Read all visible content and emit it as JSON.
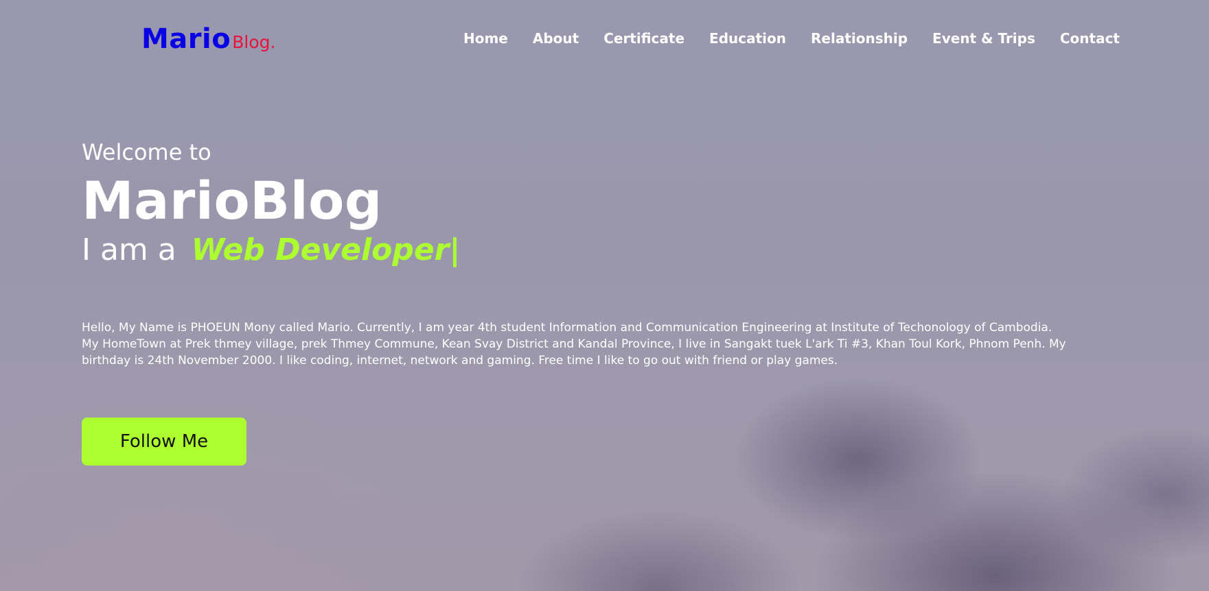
{
  "navbar": {
    "logo": {
      "main": "Mario",
      "sub": "Blog."
    },
    "links": [
      {
        "label": "Home"
      },
      {
        "label": "About"
      },
      {
        "label": "Certificate"
      },
      {
        "label": "Education"
      },
      {
        "label": "Relationship"
      },
      {
        "label": "Event & Trips"
      },
      {
        "label": "Contact"
      }
    ]
  },
  "hero": {
    "welcome": "Welcome to",
    "title": "MarioBlog",
    "role_prefix": "I am a",
    "role": "Web Developer|",
    "bio": "Hello, My Name is PHOEUN Mony called Mario. Currently, I am year 4th student Information and Communication Engineering at Institute of Techonology of Cambodia. My HomeTown at Prek thmey village, prek Thmey Commune, Kean Svay District and Kandal Province, I live in Sangakt tuek L'ark Ti #3, Khan Toul Kork, Phnom Penh. My birthday is 24th November 2000. I like coding, internet, network and gaming. Free time I like to go out with friend or play games.",
    "cta_label": "Follow Me"
  },
  "colors": {
    "logo_main": "#0a00e6",
    "logo_sub": "#e6143c",
    "accent": "#adff2f",
    "text": "#ffffff",
    "button_text": "#111111"
  }
}
